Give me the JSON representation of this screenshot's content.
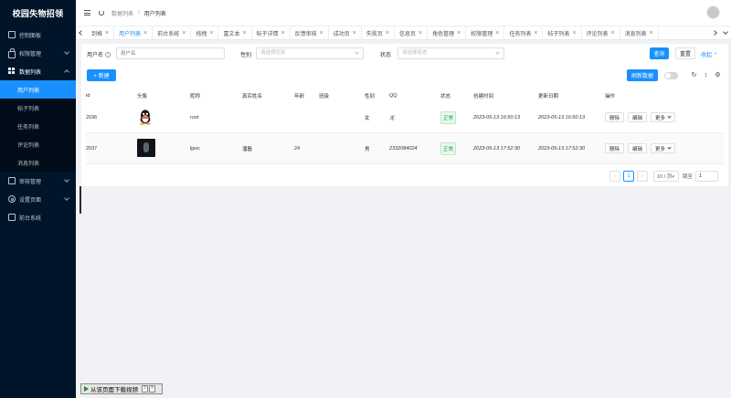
{
  "app": {
    "brand": "校园失物招领"
  },
  "sidebar": {
    "items": [
      {
        "label": "控制面板",
        "icon": "monitor-icon"
      },
      {
        "label": "权限管理",
        "icon": "lock-icon"
      },
      {
        "label": "数据列表",
        "icon": "grid-icon",
        "open": true
      },
      {
        "label": "审核管理",
        "icon": "document-icon"
      },
      {
        "label": "设置页面",
        "icon": "gear-icon"
      },
      {
        "label": "前台系统",
        "icon": "monitor-icon"
      }
    ],
    "sub_items": [
      {
        "label": "用户列表",
        "active": true
      },
      {
        "label": "帖子列表"
      },
      {
        "label": "任务列表"
      },
      {
        "label": "评论列表"
      },
      {
        "label": "消息列表"
      }
    ]
  },
  "topbar": {
    "breadcrumb": [
      "数据列表",
      "用户列表"
    ]
  },
  "tabs": [
    {
      "label": "到格"
    },
    {
      "label": "用户列表",
      "active": true
    },
    {
      "label": "前台系统"
    },
    {
      "label": "拖拽"
    },
    {
      "label": "富文本"
    },
    {
      "label": "帖子详情"
    },
    {
      "label": "反馈审核"
    },
    {
      "label": "成功页"
    },
    {
      "label": "失败页"
    },
    {
      "label": "信息页"
    },
    {
      "label": "角色管理"
    },
    {
      "label": "权限管理"
    },
    {
      "label": "任务列表"
    },
    {
      "label": "帖子列表"
    },
    {
      "label": "评论列表"
    },
    {
      "label": "消息列表"
    }
  ],
  "search": {
    "username_label": "用户名",
    "username_placeholder": "用户名",
    "gender_label": "性别",
    "gender_placeholder": "请选择性别",
    "status_label": "状态",
    "status_placeholder": "请选择状态",
    "query_label": "查询",
    "reset_label": "重置",
    "collapse_label": "收起"
  },
  "toolbar": {
    "new_label": "+ 新建",
    "refresh_data_label": "刷新数据"
  },
  "table": {
    "columns": [
      "id",
      "头像",
      "昵称",
      "真实姓名",
      "年龄",
      "班级",
      "性别",
      "QQ",
      "状态",
      "创建时间",
      "更新日期",
      "操作"
    ],
    "rows": [
      {
        "id": "2036",
        "avatar": "qq-penguin",
        "nickname": "root",
        "real_name": "",
        "age": "",
        "class": "",
        "gender": "女",
        "qq": "无",
        "status": "正常",
        "created": "2023-05-13 16:50:13",
        "updated": "2023-05-13 16:50:13"
      },
      {
        "id": "2037",
        "avatar": "dark-photo",
        "nickname": "ljpvc",
        "real_name": "潘磊",
        "age": "24",
        "class": "",
        "gender": "男",
        "qq": "2332084024",
        "status": "正常",
        "created": "2023-05-13 17:52:30",
        "updated": "2023-05-13 17:52:30"
      }
    ],
    "ops": {
      "delete": "删除",
      "edit": "编辑",
      "more": "更多"
    }
  },
  "pagination": {
    "current_page": "1",
    "page_size": "10 / 页",
    "jump_label": "跳至",
    "jump_value": "1"
  },
  "download_widget": {
    "label": "从该页面下载视频",
    "help": "?"
  },
  "colors": {
    "primary": "#1890ff",
    "sidebar_bg": "#001529",
    "success": "#1a9c4e"
  }
}
